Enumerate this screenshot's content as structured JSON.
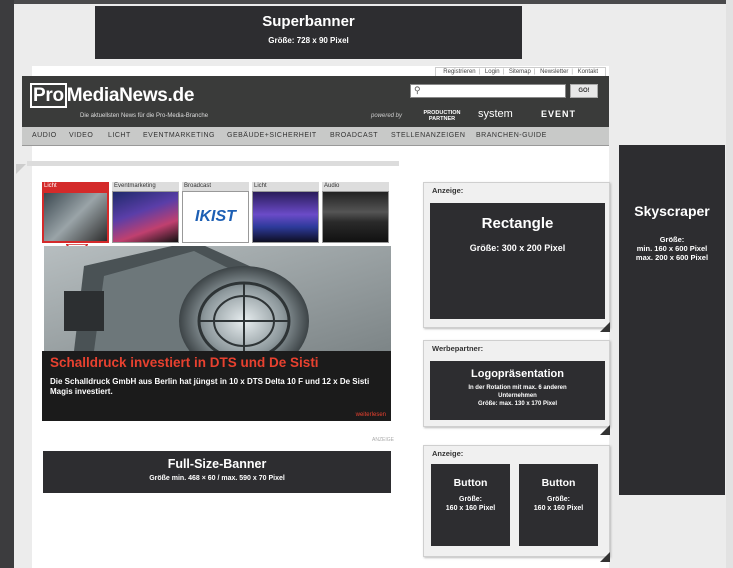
{
  "superbanner": {
    "title": "Superbanner",
    "size": "Größe: 728 x 90 Pixel"
  },
  "skyscraper": {
    "title": "Skyscraper",
    "size": "Größe:\nmin. 160 x 600 Pixel\nmax. 200 x 600 Pixel"
  },
  "site": {
    "toplinks": [
      "Registrieren",
      "Login",
      "Sitemap",
      "Newsletter",
      "Kontakt"
    ],
    "logo_pro": "Pro",
    "logo_rest": "MediaNews.de",
    "tagline": "Die aktuellsten News für die Pro-Media-Branche",
    "search_button": "GO!",
    "powered_by": "powered by",
    "partners": [
      "PRODUCTION PARTNER",
      "system",
      "EVENT"
    ],
    "nav": [
      "AUDIO",
      "VIDEO",
      "LICHT",
      "EVENTMARKETING",
      "GEBÄUDE+SICHERHEIT",
      "BROADCAST",
      "STELLENANZEIGEN",
      "BRANCHEN-GUIDE"
    ]
  },
  "thumbs": [
    "Licht",
    "Eventmarketing",
    "Broadcast",
    "Licht",
    "Audio"
  ],
  "thumb_text_broadcast": "IKIST",
  "story": {
    "title": "Schalldruck investiert in DTS und De Sisti",
    "text": "Die Schalldruck GmbH aus Berlin hat jüngst in 10 x DTS Delta 10 F und 12 x De Sisti Magis investiert.",
    "more": "weiterlesen"
  },
  "mini_anzeige": "ANZEIGE",
  "fullsize": {
    "title": "Full-Size-Banner",
    "size": "Größe min. 468 × 60 / max. 590 x 70 Pixel"
  },
  "sidebar": {
    "anzeige1": "Anzeige:",
    "rectangle": {
      "title": "Rectangle",
      "size": "Größe: 300 x 200 Pixel"
    },
    "werbepartner": "Werbepartner:",
    "logo": {
      "title": "Logopräsentation",
      "size": "In der Rotation mit max. 6 anderen\nUnternehmen\nGröße: max. 130 x 170 Pixel"
    },
    "anzeige2": "Anzeige:",
    "button1": {
      "title": "Button",
      "size": "Größe:\n160 x 160 Pixel"
    },
    "button2": {
      "title": "Button",
      "size": "Größe:\n160 x 160 Pixel"
    }
  },
  "colors": {
    "ad_box": "#2d2d30",
    "header": "#3a3b3a",
    "accent_red": "#d42a2a"
  }
}
